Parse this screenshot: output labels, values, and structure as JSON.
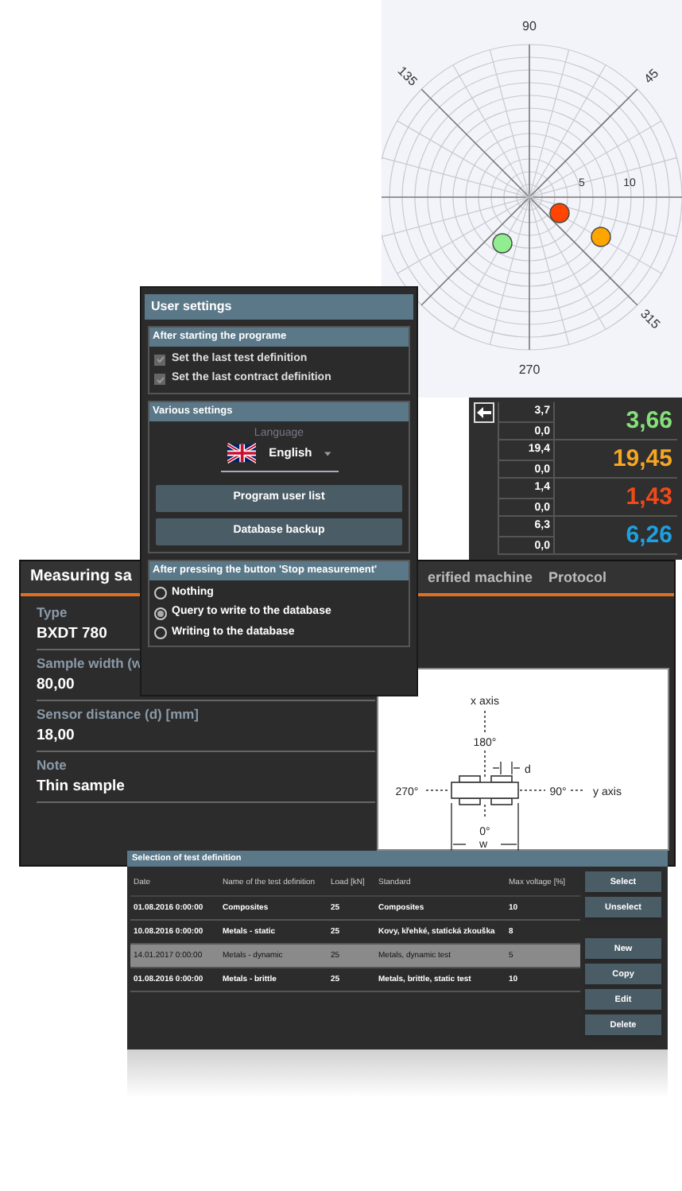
{
  "polar_plot": {
    "angle_labels": [
      "90",
      "45",
      "135",
      "315",
      "270"
    ],
    "radius_labels": [
      "5",
      "10"
    ],
    "points": [
      {
        "color": "#ff4500"
      },
      {
        "color": "#ffa500"
      },
      {
        "color": "#90ee90"
      }
    ]
  },
  "readings": [
    {
      "upper": "3,7",
      "lower": "0,0",
      "value": "3,66",
      "color": "#86e07a"
    },
    {
      "upper": "19,4",
      "lower": "0,0",
      "value": "19,45",
      "color": "#f5a623"
    },
    {
      "upper": "1,4",
      "lower": "0,0",
      "value": "1,43",
      "color": "#f04a1a"
    },
    {
      "upper": "6,3",
      "lower": "0,0",
      "value": "6,26",
      "color": "#1ea0e0"
    }
  ],
  "user_settings": {
    "title": "User settings",
    "startup": {
      "title": "After starting the programe",
      "options": [
        {
          "label": "Set the last test definition",
          "checked": true,
          "disabled": true
        },
        {
          "label": "Set the last contract definition",
          "checked": true,
          "disabled": true
        }
      ]
    },
    "various": {
      "title": "Various settings",
      "language_label": "Language",
      "language": "English",
      "buttons": [
        "Program user list",
        "Database backup"
      ]
    },
    "stop": {
      "title": "After pressing the button 'Stop measurement'",
      "options": [
        {
          "label": "Nothing",
          "selected": false
        },
        {
          "label": "Query to write to the database",
          "selected": true
        },
        {
          "label": "Writing to the database",
          "selected": false
        }
      ]
    }
  },
  "measuring": {
    "title": "Measuring sa",
    "tabs": [
      "erified machine",
      "Protocol"
    ],
    "fields": [
      {
        "label": "Type",
        "value": "BXDT 780"
      },
      {
        "label": "Sample width (w",
        "value": "80,00"
      },
      {
        "label": "Sensor distance (d) [mm]",
        "value": "18,00"
      },
      {
        "label": "Note",
        "value": "Thin sample"
      }
    ],
    "diagram": {
      "x_axis": "x axis",
      "top": "180°",
      "d": "d",
      "left": "270°",
      "right": "90°",
      "y_axis": "y axis",
      "bottom": "0°",
      "w": "w"
    }
  },
  "test_definitions": {
    "title": "Selection of test definition",
    "columns": [
      "Date",
      "Name of the test definition",
      "Load [kN]",
      "Standard",
      "Max voltage [%]"
    ],
    "rows": [
      {
        "cells": [
          "01.08.2016 0:00:00",
          "Composites",
          "25",
          "Composites",
          "10"
        ],
        "selected": false
      },
      {
        "cells": [
          "10.08.2016 0:00:00",
          "Metals - static",
          "25",
          "Kovy, křehké, statická zkouška",
          "8"
        ],
        "selected": false
      },
      {
        "cells": [
          "14.01.2017 0:00:00",
          "Metals - dynamic",
          "25",
          "Metals, dynamic test",
          "5"
        ],
        "selected": true
      },
      {
        "cells": [
          "01.08.2016 0:00:00",
          "Metals - brittle",
          "25",
          "Metals, brittle, static test",
          "10"
        ],
        "selected": false
      }
    ],
    "buttons": [
      "Select",
      "Unselect",
      "New",
      "Copy",
      "Edit",
      "Delete"
    ]
  }
}
